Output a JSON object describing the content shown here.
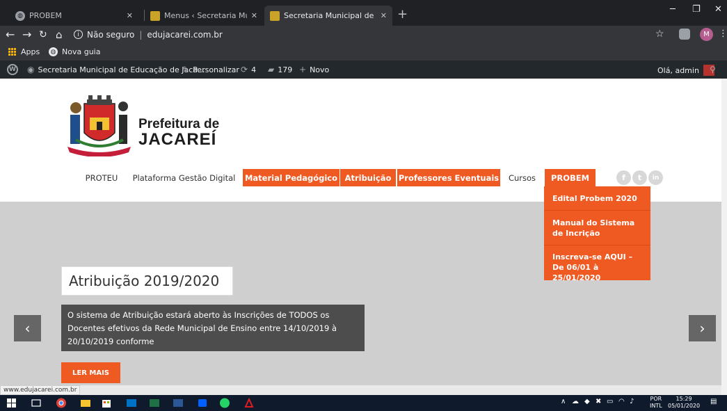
{
  "tabs": [
    {
      "label": "PROBEM"
    },
    {
      "label": "Menus ‹ Secretaria Municipal de"
    },
    {
      "label": "Secretaria Municipal de Educaçã"
    }
  ],
  "toolbar": {
    "security": "Não seguro",
    "url": "edujacarei.com.br",
    "profile_initial": "M"
  },
  "bookmarks": [
    {
      "label": "Apps"
    },
    {
      "label": "Nova guia"
    }
  ],
  "adminbar": {
    "site_name": "Secretaria Municipal de Educação de Jaca...",
    "customize": "Personalizar",
    "updates": "4",
    "comments": "179",
    "new": "Novo",
    "greeting": "Olá, admin"
  },
  "brand": {
    "line1": "Prefeitura de",
    "line2": "JACAREÍ"
  },
  "nav": [
    {
      "label": "PROTEU"
    },
    {
      "label": "Plataforma Gestão Digital"
    },
    {
      "label": "Material Pedagógico"
    },
    {
      "label": "Atribuição"
    },
    {
      "label": "Professores Eventuais"
    },
    {
      "label": "Cursos"
    },
    {
      "label": "PROBEM"
    }
  ],
  "social": [
    "f",
    "t",
    "in"
  ],
  "dropdown": [
    {
      "label": "Edital Probem 2020"
    },
    {
      "label": "Manual do Sistema de Incrição"
    },
    {
      "label": "Inscreva-se AQUI – De 06/01 à 25/01/2020"
    }
  ],
  "hero": {
    "title": "Atribuição 2019/2020",
    "description": "O sistema de Atribuição estará aberto às Inscrições de TODOS os Docentes efetivos da Rede Municipal de Ensino entre 14/10/2019 à 20/10/2019 conforme",
    "button": "LER MAIS"
  },
  "status_url": "www.edujacarei.com.br",
  "taskbar": {
    "lang_line1": "POR",
    "lang_line2": "INTL",
    "time": "15:29",
    "date": "05/01/2020"
  },
  "colors": {
    "accent": "#ef5a23",
    "admin_bar": "#23282d",
    "hero_bg": "#cfcfcf"
  }
}
